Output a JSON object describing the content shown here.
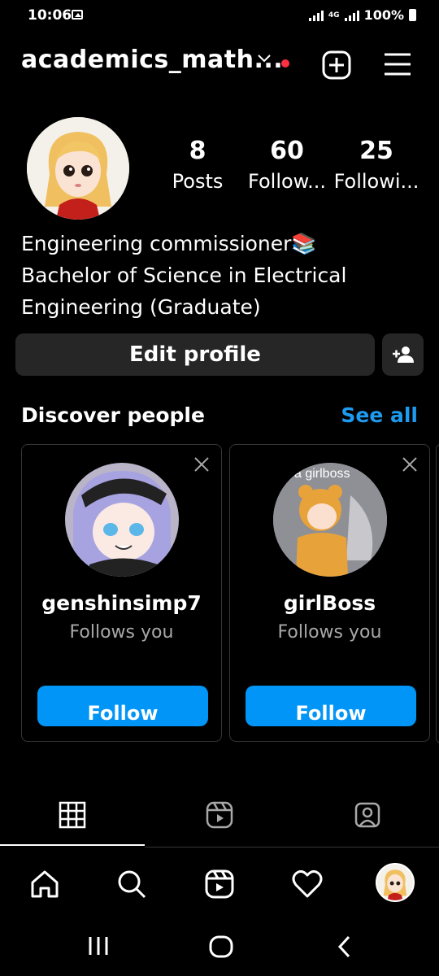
{
  "status_bar": {
    "time": "10:06",
    "network": "4G",
    "battery": "100%"
  },
  "header": {
    "username": "academics_math..."
  },
  "profile": {
    "stats": [
      {
        "value": "8",
        "label": "Posts"
      },
      {
        "value": "60",
        "label": "Follow..."
      },
      {
        "value": "25",
        "label": "Followi..."
      }
    ],
    "bio": [
      "Engineering commissioner📚",
      "Bachelor of Science in Electrical",
      "Engineering (Graduate)"
    ]
  },
  "actions": {
    "edit_label": "Edit profile"
  },
  "discover": {
    "title": "Discover people",
    "see_all": "See all",
    "cards": [
      {
        "name": "genshinsimp7",
        "subtitle": "Follows you",
        "button": "Follow"
      },
      {
        "name": "girlBoss",
        "subtitle": "Follows you",
        "button": "Follow",
        "photo_text": "a girlboss"
      }
    ]
  },
  "icons": {
    "tabs": [
      "grid-icon",
      "reels-icon",
      "tagged-icon"
    ],
    "nav": [
      "home-icon",
      "search-icon",
      "reels-icon",
      "heart-icon",
      "profile-avatar"
    ]
  },
  "colors": {
    "background": "#000000",
    "accent": "#0095f6",
    "link": "#1d9bf0",
    "button_bg": "#262626",
    "notification_dot": "#ff3040"
  }
}
